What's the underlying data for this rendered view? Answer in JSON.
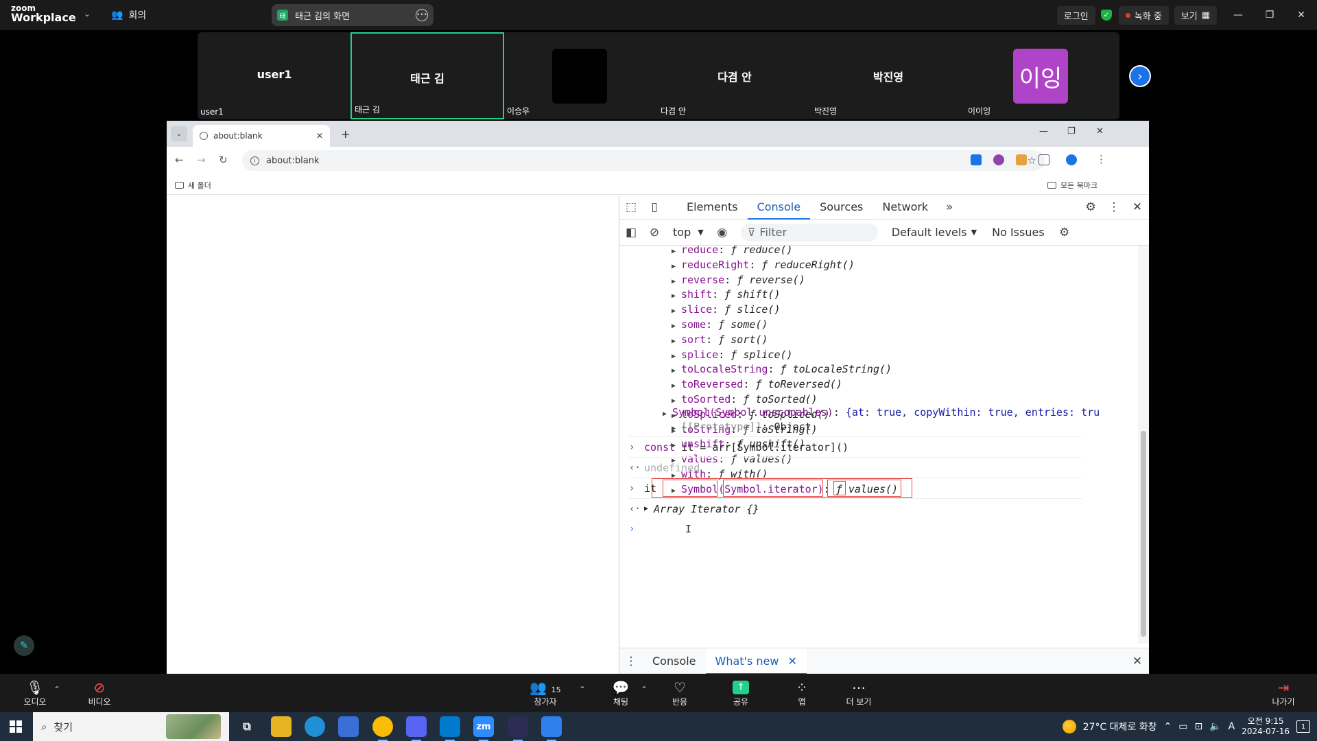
{
  "zoom": {
    "logo_line1": "zoom",
    "logo_line2": "Workplace",
    "meeting_label": "회의",
    "share_title": "태근 김의 화면",
    "share_icon_text": "태",
    "login_label": "로그인",
    "recording_label": "녹화 중",
    "view_label": "보기"
  },
  "participants": [
    {
      "name": "user1",
      "label": "user1"
    },
    {
      "name": "태근 김",
      "label": "태근 김"
    },
    {
      "name": "",
      "label": "이승우"
    },
    {
      "name": "다겸 안",
      "label": "다겸 안"
    },
    {
      "name": "박진영",
      "label": "박진영"
    },
    {
      "name": "",
      "label": "이이잉",
      "avatar": "이잉"
    }
  ],
  "browser": {
    "tab_title": "about:blank",
    "address": "about:blank",
    "bookmark_folder": "새 폴더",
    "all_bookmarks": "모든 북마크"
  },
  "devtools": {
    "tabs": [
      "Elements",
      "Console",
      "Sources",
      "Network"
    ],
    "context": "top",
    "filter_placeholder": "Filter",
    "levels": "Default levels",
    "issues": "No Issues",
    "properties": [
      {
        "key": "reduce",
        "fn": "reduce()"
      },
      {
        "key": "reduceRight",
        "fn": "reduceRight()"
      },
      {
        "key": "reverse",
        "fn": "reverse()"
      },
      {
        "key": "shift",
        "fn": "shift()"
      },
      {
        "key": "slice",
        "fn": "slice()"
      },
      {
        "key": "some",
        "fn": "some()"
      },
      {
        "key": "sort",
        "fn": "sort()"
      },
      {
        "key": "splice",
        "fn": "splice()"
      },
      {
        "key": "toLocaleString",
        "fn": "toLocaleString()"
      },
      {
        "key": "toReversed",
        "fn": "toReversed()"
      },
      {
        "key": "toSorted",
        "fn": "toSorted()"
      },
      {
        "key": "toSpliced",
        "fn": "toSpliced()"
      },
      {
        "key": "toString",
        "fn": "toString()"
      },
      {
        "key": "unshift",
        "fn": "unshift()"
      },
      {
        "key": "values",
        "fn": "values()"
      },
      {
        "key": "with",
        "fn": "with()"
      },
      {
        "key": "Symbol(Symbol.iterator)",
        "fn": "values()"
      }
    ],
    "unscopables_key": "Symbol(Symbol.unscopables)",
    "unscopables_value": "{at: true, copyWithin: true, entries: tru",
    "prototype_key": "[[Prototype]]",
    "prototype_value": "Object",
    "input1_kw": "const",
    "input1_rest": "it = arr[Symbol.iterator]()",
    "output1": "undefined",
    "input2": "it",
    "output2": "Array Iterator {}",
    "drawer_tabs": [
      "Console",
      "What's new"
    ]
  },
  "toolbar": {
    "audio": "오디오",
    "video": "비디오",
    "participants": "참가자",
    "participant_count": "15",
    "chat": "채팅",
    "reactions": "반응",
    "share": "공유",
    "apps": "앱",
    "more": "더 보기",
    "leave": "나가기"
  },
  "taskbar": {
    "search_label": "찾기",
    "weather": "27°C  대체로 화창",
    "ime": "A",
    "time": "오전 9:15",
    "date": "2024-07-16",
    "notifications": "1"
  },
  "colors": {
    "accent_green": "#23d18b",
    "devtools_blue": "#1a73e8",
    "prop_purple": "#881391",
    "avatar_purple": "#b044c8"
  }
}
